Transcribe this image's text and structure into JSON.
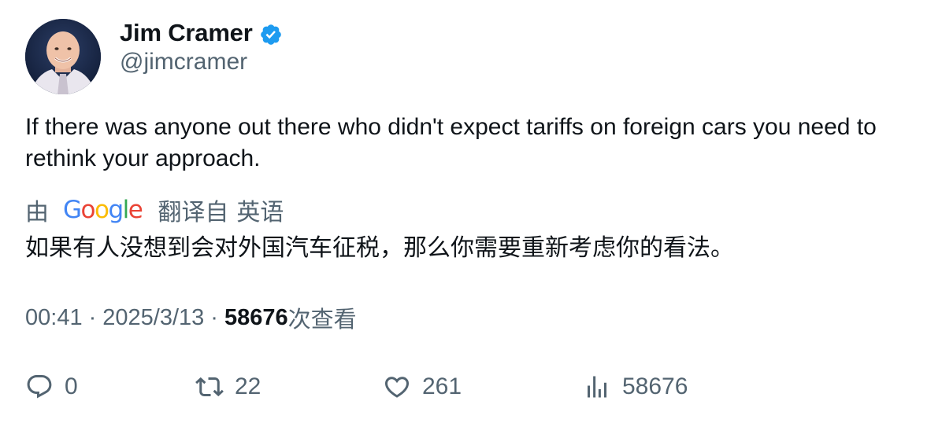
{
  "author": {
    "display_name": "Jim Cramer",
    "handle": "@jimcramer",
    "verified": true,
    "verified_color": "#1d9bf0",
    "avatar_icon": "profile-photo"
  },
  "tweet": {
    "text": "If there was anyone out there who didn't expect tariffs on foreign cars you need to rethink your approach."
  },
  "translation": {
    "by_label": "由",
    "provider": "Google",
    "from_label": "翻译自",
    "language": "英语",
    "text": "如果有人没想到会对外国汽车征税，那么你需要重新考虑你的看法。"
  },
  "meta": {
    "time": "00:41",
    "separator": "·",
    "date": "2025/3/13",
    "views_count": "58676",
    "views_suffix": "次查看"
  },
  "actions": {
    "reply": {
      "icon": "reply-icon",
      "count": "0"
    },
    "retweet": {
      "icon": "retweet-icon",
      "count": "22"
    },
    "like": {
      "icon": "heart-icon",
      "count": "261"
    },
    "views": {
      "icon": "analytics-icon",
      "count": "58676"
    }
  },
  "colors": {
    "text_primary": "#0f1419",
    "text_secondary": "#536471",
    "accent": "#1d9bf0"
  }
}
